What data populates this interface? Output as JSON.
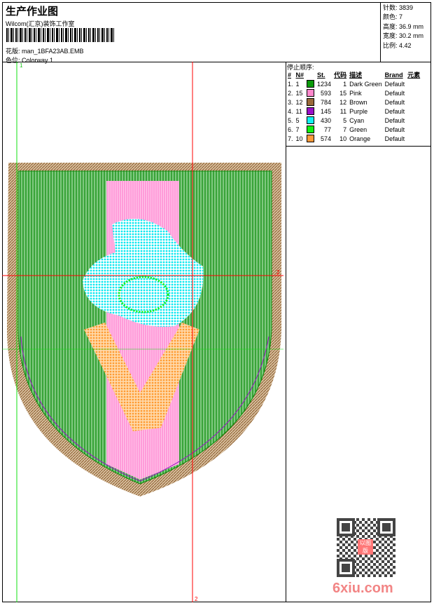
{
  "header": {
    "title": "生产作业图",
    "subtitle": "Wilcom(汇京)装饰工作室",
    "design_file": "花版: man_1BFA23AB.EMB",
    "colorway": "色位: Colorway 1"
  },
  "info": {
    "stitches": "针数: 3839",
    "colors": "颜色: 7",
    "height": "高度: 36.9 mm",
    "width": "宽度: 30.2 mm",
    "scale": "比例: 4.42"
  },
  "stop_sequence": {
    "label": "停止顺序:",
    "headers": [
      "#",
      "N#",
      "St.",
      "代码",
      "描述",
      "Brand",
      "元素"
    ],
    "rows": [
      {
        "idx": "1.",
        "n": "1",
        "color": "#0a9a0a",
        "st": "1234",
        "code": "1",
        "desc": "Dark Green",
        "brand": "Default"
      },
      {
        "idx": "2.",
        "n": "15",
        "color": "#ff88cc",
        "st": "593",
        "code": "15",
        "desc": "Pink",
        "brand": "Default"
      },
      {
        "idx": "3.",
        "n": "12",
        "color": "#9a6a3a",
        "st": "784",
        "code": "12",
        "desc": "Brown",
        "brand": "Default"
      },
      {
        "idx": "4.",
        "n": "11",
        "color": "#9a10c8",
        "st": "145",
        "code": "11",
        "desc": "Purple",
        "brand": "Default"
      },
      {
        "idx": "5.",
        "n": "5",
        "color": "#10f0f0",
        "st": "430",
        "code": "5",
        "desc": "Cyan",
        "brand": "Default"
      },
      {
        "idx": "6.",
        "n": "7",
        "color": "#10f010",
        "st": "77",
        "code": "7",
        "desc": "Green",
        "brand": "Default"
      },
      {
        "idx": "7.",
        "n": "10",
        "color": "#ff9a3a",
        "st": "574",
        "code": "10",
        "desc": "Orange",
        "brand": "Default"
      }
    ]
  },
  "guides": {
    "top": "1",
    "bottom": "2",
    "right": "2"
  },
  "qr": {
    "stamp": "以图版"
  },
  "watermark": "6xiu.com"
}
